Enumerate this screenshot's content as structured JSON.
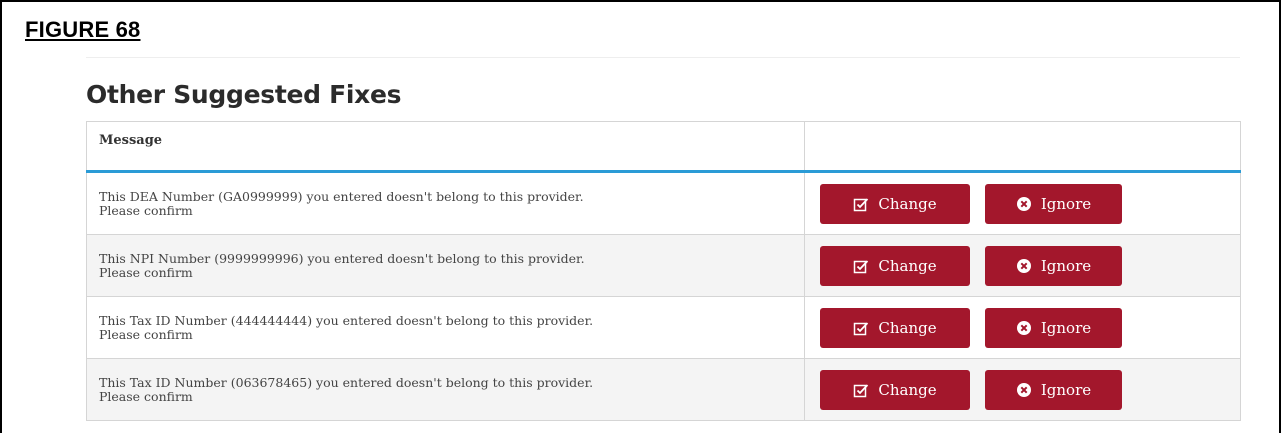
{
  "figure_label": "FIGURE 68",
  "section_title": "Other Suggested Fixes",
  "table": {
    "headers": [
      "Message",
      ""
    ],
    "rows": [
      {
        "line1": "This DEA Number (GA0999999) you entered doesn't belong to this provider.",
        "line2": "Please confirm"
      },
      {
        "line1": "This NPI Number (9999999996) you entered doesn't belong to this provider.",
        "line2": "Please confirm"
      },
      {
        "line1": "This Tax ID Number (444444444) you entered doesn't belong to this provider.",
        "line2": "Please confirm"
      },
      {
        "line1": "This Tax ID Number (063678465) you entered doesn't belong to this provider.",
        "line2": "Please confirm"
      }
    ]
  },
  "buttons": {
    "change_label": "Change",
    "ignore_label": "Ignore"
  },
  "icons": {
    "change": "edit-check-icon",
    "ignore": "times-circle-icon"
  },
  "colors": {
    "button_bg": "#a3172c",
    "header_rule": "#2a9bd6",
    "alt_row": "#f4f4f4"
  }
}
